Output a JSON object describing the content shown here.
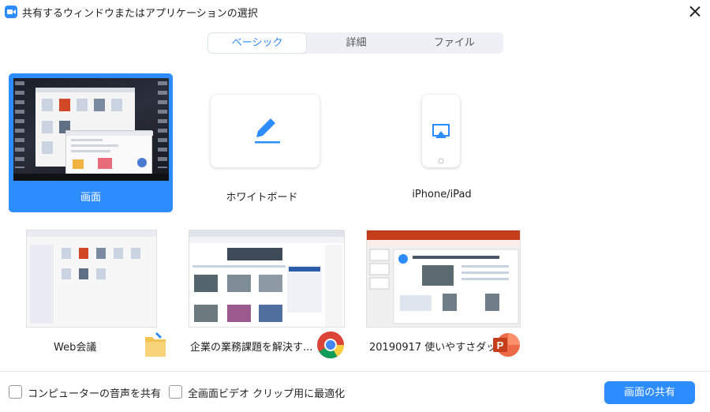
{
  "window": {
    "title": "共有するウィンドウまたはアプリケーションの選択"
  },
  "tabs": [
    {
      "label": "ベーシック",
      "active": true
    },
    {
      "label": "詳細",
      "active": false
    },
    {
      "label": "ファイル",
      "active": false
    }
  ],
  "tiles": {
    "screen": {
      "label": "画面",
      "selected": true
    },
    "whiteboard": {
      "label": "ホワイトボード",
      "icon": "pen-icon"
    },
    "iphone": {
      "label": "iPhone/iPad",
      "icon": "airplay-icon"
    },
    "web_meeting": {
      "label": "Web会議",
      "icon": "folder-icon"
    },
    "browser": {
      "label": "企業の業務課題を解決す...",
      "icon": "chrome-icon"
    },
    "powerpoint": {
      "label": "20190917 使いやすさダッ...",
      "icon": "powerpoint-icon"
    }
  },
  "footer": {
    "share_audio": "コンピューターの音声を共有",
    "optimize_video": "全画面ビデオ クリップ用に最適化",
    "share_button": "画面の共有"
  },
  "colors": {
    "accent": "#2d8cff",
    "powerpoint": "#d35230"
  }
}
